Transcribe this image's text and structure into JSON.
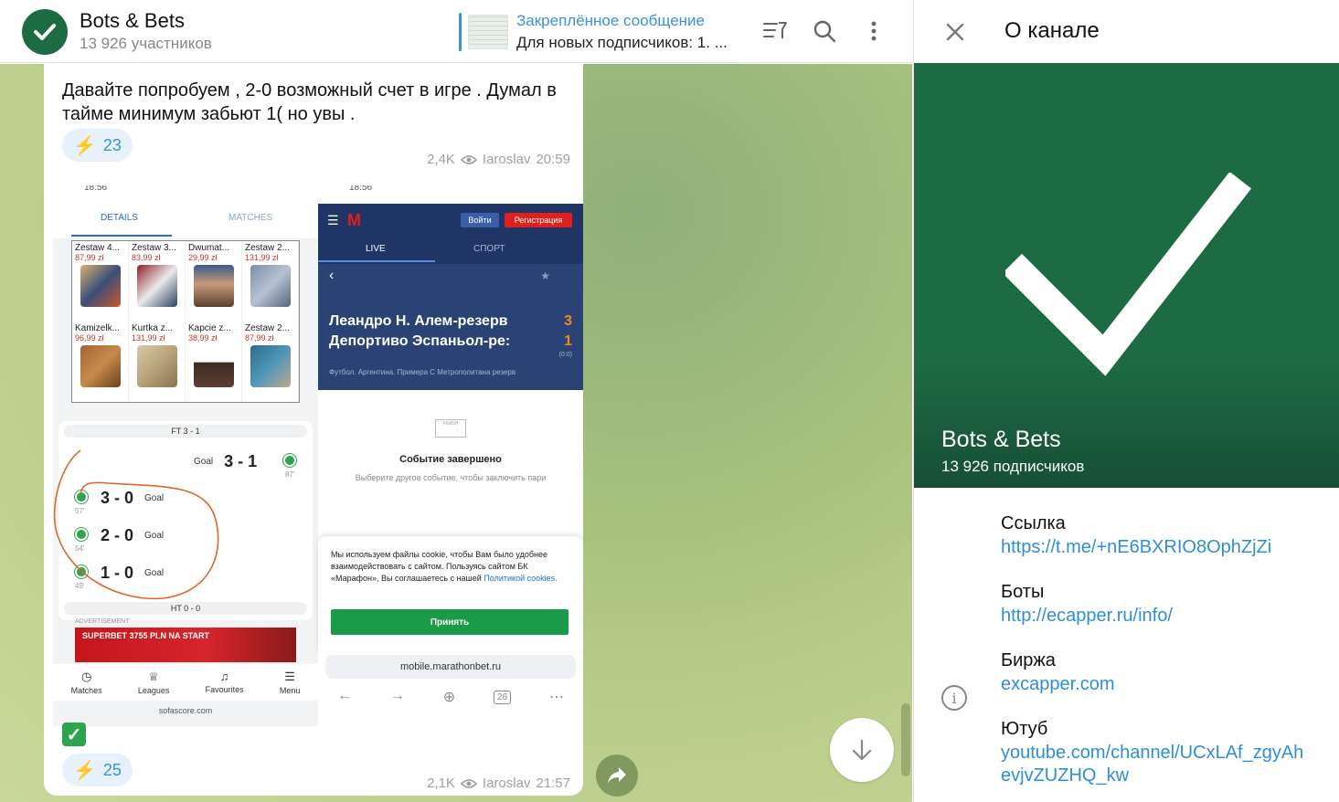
{
  "header": {
    "channel_title": "Bots & Bets",
    "members": "13 926 участников",
    "pinned_title": "Закреплённое сообщение",
    "pinned_text": "Для новых подписчиков: 1. ...",
    "icons": [
      "checkmark-icon",
      "filter-icon",
      "search-icon",
      "more-icon"
    ]
  },
  "messages": [
    {
      "text": "Давайте попробуем , 2-0 возможный счет в игре . Думал в тайме минимум забьют 1( но увы .",
      "reaction": "23",
      "views": "2,4K",
      "author": "Iaroslav",
      "time": "20:59"
    },
    {
      "reaction": "25",
      "views": "2,1K",
      "author": "Iaroslav",
      "time": "21:57",
      "left_screenshot": {
        "status": "18:56",
        "tabs": [
          "DETAILS",
          "MATCHES"
        ],
        "ads": [
          {
            "title": "Zestaw 4...",
            "price": "87,99 zł"
          },
          {
            "title": "Zestaw 3...",
            "price": "83,99 zł"
          },
          {
            "title": "Dwumat...",
            "price": "29,99 zł"
          },
          {
            "title": "Zestaw 2...",
            "price": "131,99 zł"
          },
          {
            "title": "Kamizelk...",
            "price": "96,99 zł"
          },
          {
            "title": "Kurtka z...",
            "price": "131,99 zł"
          },
          {
            "title": "Kapcie z...",
            "price": "38,99 zł"
          },
          {
            "title": "Zestaw 2...",
            "price": "87,99 zł"
          }
        ],
        "ft": "FT 3 - 1",
        "ht": "HT 0 - 0",
        "goals": [
          {
            "score": "3 - 1",
            "label": "Goal",
            "minute": "87'"
          },
          {
            "score": "3 - 0",
            "label": "Goal",
            "minute": "57'"
          },
          {
            "score": "2 - 0",
            "label": "Goal",
            "minute": "54'"
          },
          {
            "score": "1 - 0",
            "label": "Goal",
            "minute": "49'"
          }
        ],
        "advert_label": "ADVERTISEMENT",
        "banner_text": "SUPERBET 3755 PLN NA START",
        "nav": [
          "Matches",
          "Leagues",
          "Favourites",
          "Menu"
        ],
        "url": "sofascore.com"
      },
      "right_screenshot": {
        "status": "18:56",
        "logo": "M",
        "login": "Войти",
        "register": "Регистрация",
        "tabs": [
          "LIVE",
          "СПОРТ"
        ],
        "team1": "Леандро Н. Алем-резерв",
        "team2": "Депортиво Эспаньол-ре:",
        "score1": "3",
        "score2": "1",
        "ht_small": "(0:0)",
        "league": "Футбол. Аргентина. Примера С Метрополитана резерв",
        "finish_badge": "FINISH",
        "finish_title": "Событие завершено",
        "finish_sub": "Выберите другое событие, чтобы заключить пари",
        "cookie_text": "Мы используем файлы cookie, чтобы Вам было удобнее взаимодействовать с сайтом. Пользуясь сайтом БК «Марафон», Вы соглашаетесь с нашей",
        "cookie_link": "Политикой cookies.",
        "accept": "Принять",
        "url": "mobile.marathonbet.ru",
        "tab_count": "26"
      }
    }
  ],
  "info_panel": {
    "title": "О канале",
    "name": "Bots & Bets",
    "subscribers": "13 926 подписчиков",
    "accent": "#1d6b43",
    "fields": [
      {
        "label": "Ссылка",
        "value": "https://t.me/+nE6BXRIO8OphZjZi"
      },
      {
        "label": "Боты",
        "value": "http://ecapper.ru/info/"
      },
      {
        "label": "Биржа",
        "value": "excapper.com"
      },
      {
        "label": "Ютуб",
        "value": "youtube.com/channel/UCxLAf_zgyAh",
        "value2": "evjvZUZHQ_kw"
      }
    ]
  }
}
